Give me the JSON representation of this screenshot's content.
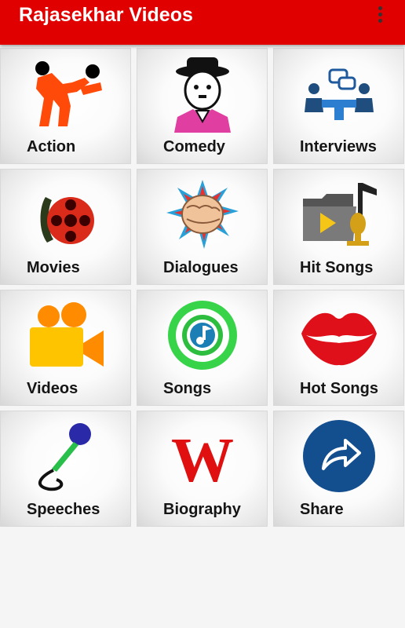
{
  "appbar": {
    "title": "Rajasekhar Videos",
    "overflow_icon": "more-vert-icon",
    "background": "#e00000"
  },
  "tiles": [
    {
      "label": "Action",
      "icon": "action-fighting-icon"
    },
    {
      "label": "Comedy",
      "icon": "comedy-character-icon"
    },
    {
      "label": "Interviews",
      "icon": "interview-people-icon"
    },
    {
      "label": "Movies",
      "icon": "film-reel-icon"
    },
    {
      "label": "Dialogues",
      "icon": "fist-punch-icon"
    },
    {
      "label": "Hit Songs",
      "icon": "music-folder-icon"
    },
    {
      "label": "Videos",
      "icon": "video-camera-icon"
    },
    {
      "label": "Songs",
      "icon": "music-note-circle-icon"
    },
    {
      "label": "Hot Songs",
      "icon": "lips-icon"
    },
    {
      "label": "Speeches",
      "icon": "microphone-icon"
    },
    {
      "label": "Biography",
      "icon": "wikipedia-w-icon"
    },
    {
      "label": "Share",
      "icon": "share-arrow-icon"
    }
  ]
}
